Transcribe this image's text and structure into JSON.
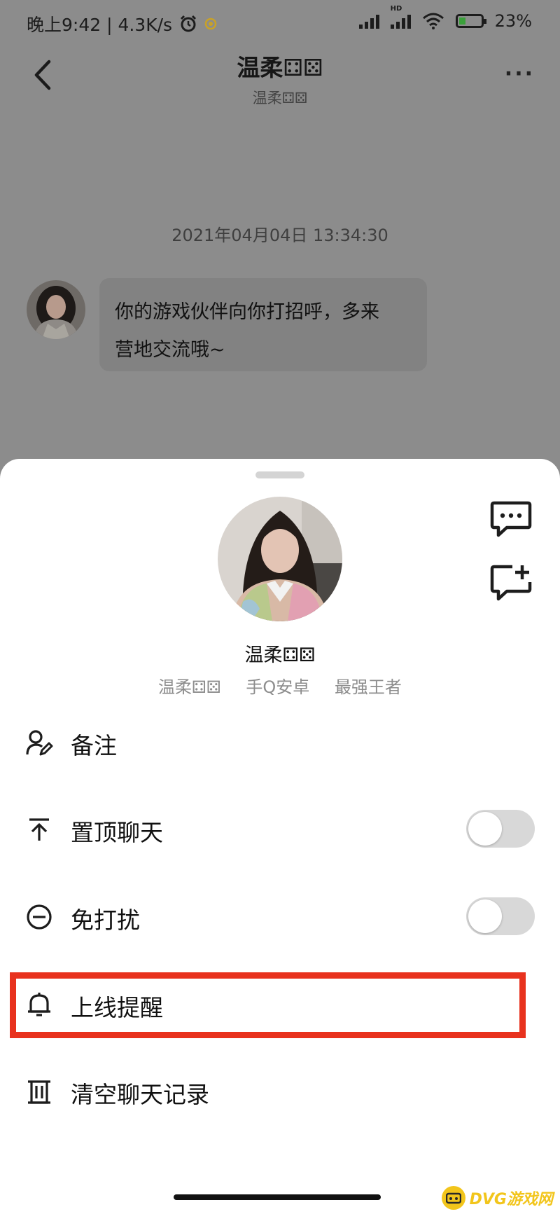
{
  "status_bar": {
    "time": "晚上9:42 | 4.3K/s",
    "battery": "23%",
    "network": "HD"
  },
  "nav": {
    "title": "温柔⚃⚄",
    "subtitle": "温柔⚃⚄"
  },
  "chat": {
    "timestamp": "2021年04月04日 13:34:30",
    "messages": [
      {
        "line1": "你的游戏伙伴向你打招呼，多来",
        "line2": "营地交流哦~"
      }
    ]
  },
  "sheet": {
    "name": "温柔⚃⚄",
    "tags": [
      "温柔⚃⚄",
      "手Q安卓",
      "最强王者"
    ],
    "menu": [
      {
        "label": "备注"
      },
      {
        "label": "置顶聊天",
        "toggle": false
      },
      {
        "label": "免打扰",
        "toggle": false
      },
      {
        "label": "上线提醒",
        "highlighted": true
      },
      {
        "label": "清空聊天记录"
      }
    ]
  },
  "watermark": {
    "text": "DVG游戏网"
  },
  "colors": {
    "highlight": "#e8321e",
    "watermark": "#f2c51b"
  }
}
